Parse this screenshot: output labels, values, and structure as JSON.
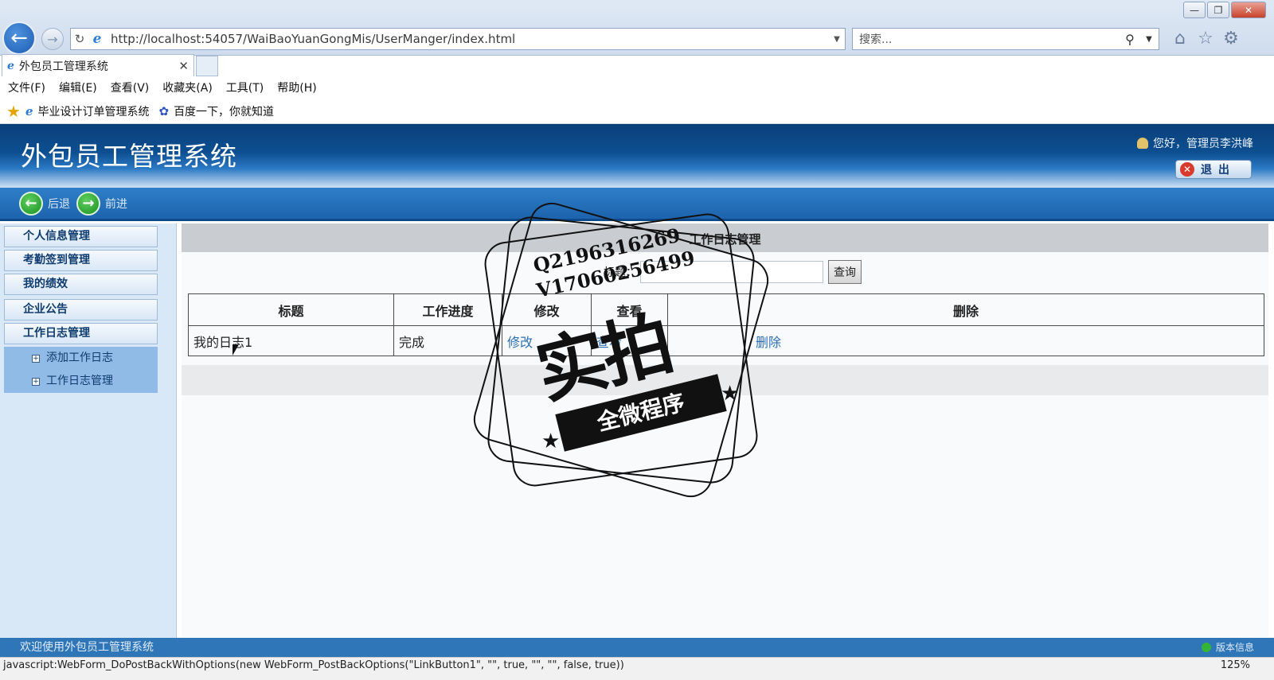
{
  "browser": {
    "url": "http://localhost:54057/WaiBaoYuanGongMis/UserManger/index.html",
    "search_placeholder": "搜索...",
    "tab_title": "外包员工管理系统",
    "menu": [
      "文件(F)",
      "编辑(E)",
      "查看(V)",
      "收藏夹(A)",
      "工具(T)",
      "帮助(H)"
    ],
    "favorites": [
      "毕业设计订单管理系统",
      "百度一下，你就知道"
    ],
    "status_text": "javascript:WebForm_DoPostBackWithOptions(new WebForm_PostBackOptions(\"LinkButton1\", \"\", true, \"\", \"\", false, true))",
    "zoom": "125%"
  },
  "app": {
    "title": "外包员工管理系统",
    "greeting": "您好，管理员李洪峰",
    "logout": "退出",
    "nav_back": "后退",
    "nav_forward": "前进",
    "footer_text": "欢迎使用外包员工管理系统",
    "version_info": "版本信息"
  },
  "sidebar": {
    "items": [
      "个人信息管理",
      "考勤签到管理",
      "我的绩效",
      "企业公告",
      "工作日志管理"
    ],
    "subitems": [
      "添加工作日志",
      "工作日志管理"
    ]
  },
  "main": {
    "title": "工作日志管理",
    "search_label": "标题：",
    "search_button": "查询",
    "columns": [
      "标题",
      "工作进度",
      "修改",
      "查看",
      "删除"
    ],
    "rows": [
      {
        "title": "我的日志1",
        "progress": "完成",
        "edit": "修改",
        "view": "查看",
        "delete": "删除"
      }
    ]
  },
  "watermark": {
    "line1": "Q2196316269",
    "line2": "V17060256499",
    "main": "实拍",
    "ribbon": "全微程序"
  },
  "colors": {
    "header_dark": "#0a3f78",
    "nav_blue": "#2f7ec9",
    "link": "#2c6fb4",
    "sidebar_bg": "#d9e8f7"
  }
}
